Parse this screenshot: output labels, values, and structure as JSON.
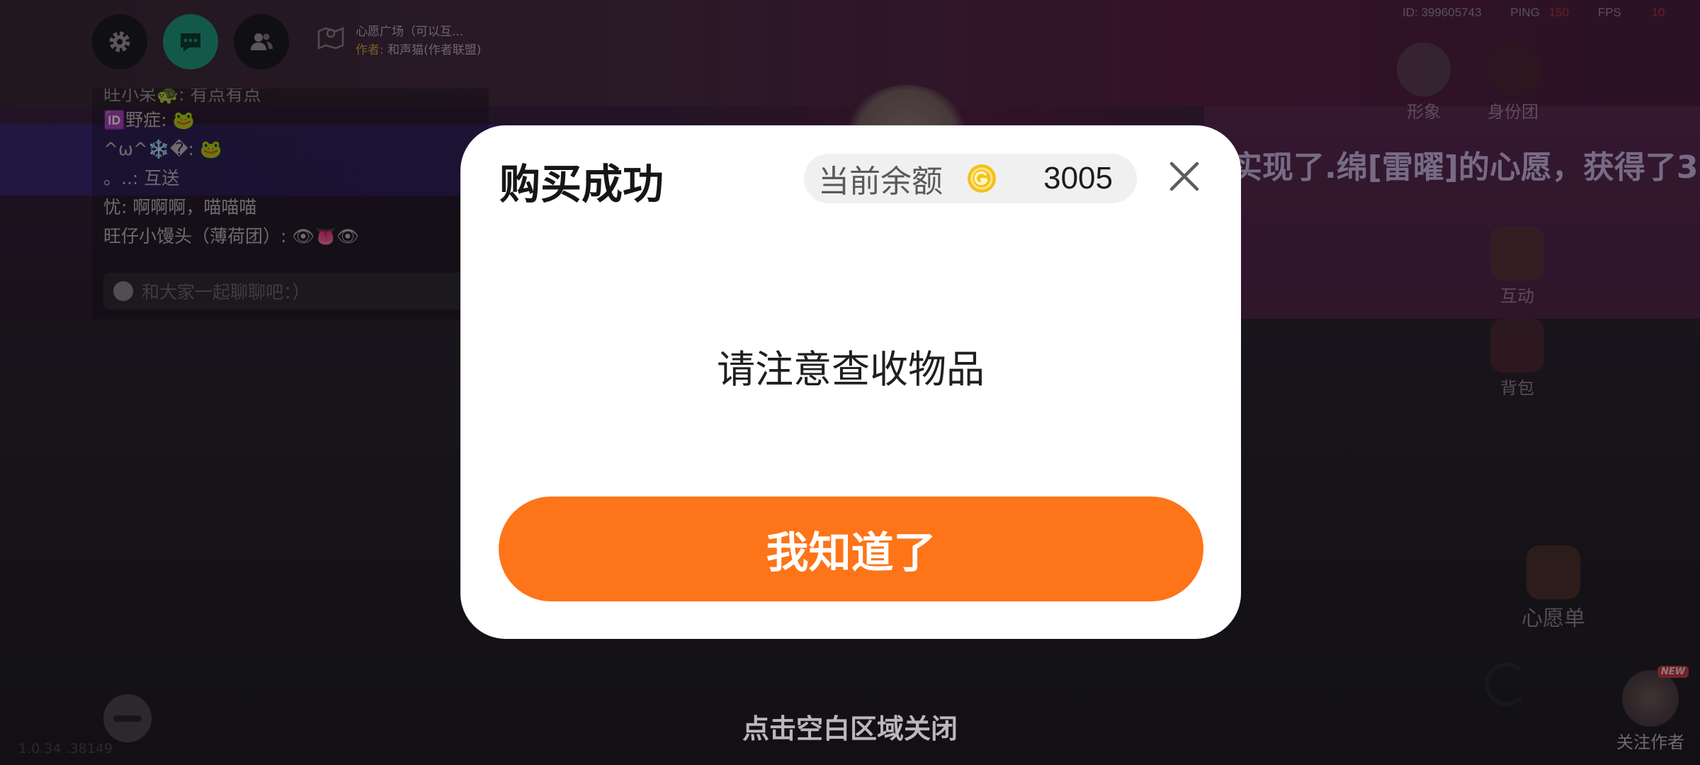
{
  "hud": {
    "map_title": "心愿广场（可以互...",
    "author_label": "作者:",
    "author_name": "和声猫(作者联盟)"
  },
  "status": {
    "id": "ID: 399605743",
    "ping_label": "PING",
    "ping_value": "150",
    "fps_label": "FPS",
    "fps_value": "10"
  },
  "side_menu": {
    "appearance": "形象",
    "identity_group": "身份团",
    "interact": "互动",
    "backpack": "背包",
    "wishlist": "心愿单"
  },
  "announcement": "实现了.绵[雷曜]的心愿，获得了3",
  "chat": {
    "messages": [
      "旺小呆🐢: 有点有点",
      "🆔野症: 🐸",
      "^ω^❄️�: 🐸",
      "。..: 互送",
      "忧: 啊啊啊，喵喵喵",
      "旺仔小馒头（薄荷团）: 👁👅👁"
    ],
    "input_placeholder": "和大家一起聊聊吧：）"
  },
  "coords": "1.0.34 .38149",
  "follow": {
    "badge": "NEW",
    "label": "关注作者"
  },
  "close_hint": "点击空白区域关闭",
  "modal": {
    "title": "购买成功",
    "balance_label": "当前余额",
    "balance_value": "3005",
    "message": "请注意查收物品",
    "confirm_button": "我知道了"
  },
  "colors": {
    "accent": "#fe7418",
    "coin": "#f3c21c",
    "chat_active": "#1f9a7e"
  }
}
